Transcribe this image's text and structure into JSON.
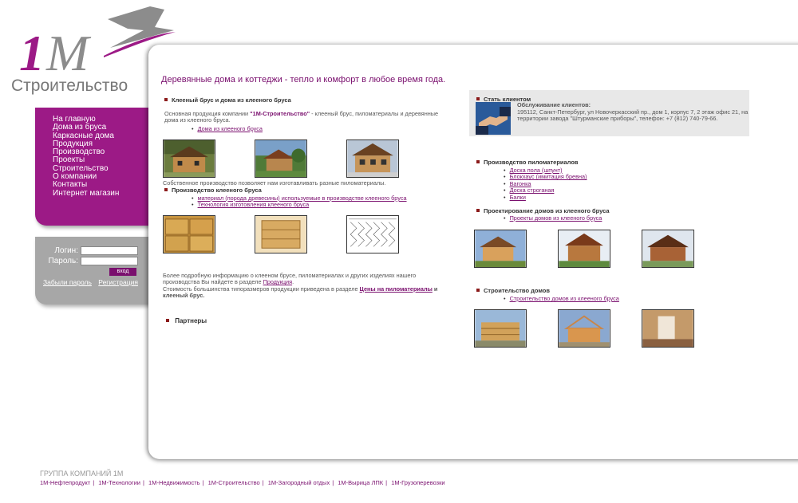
{
  "logo": {
    "mark": "1M",
    "word": "Строительство"
  },
  "menu": [
    "На главную",
    "Дома из бруса",
    "Каркасные дома",
    "Продукция",
    "Производство",
    "Проекты",
    "Строительство",
    "О компании",
    "Контакты",
    "Интернет магазин"
  ],
  "login": {
    "login_label": "Логин:",
    "password_label": "Пароль:",
    "submit": "вход",
    "forgot": "Забыли пароль",
    "register": "Регистрация"
  },
  "headline": "Деревянные дома и коттеджи - тепло и комфорт в любое время года.",
  "left": {
    "sec1_title": "Клееный брус и дома из клееного бруса",
    "sec1_text_a": "Основная продукция компании ",
    "sec1_text_brand": "\"1М-Строительство\"",
    "sec1_text_b": " - клееный брус, пиломатериалы и деревянные дома из клееного бруса.",
    "sec1_link": "Дома из клееного бруса",
    "own_prod": "Собственное производство позволяет нам изготавливать разные пиломатериалы.",
    "sec2_title": "Производство клееного бруса",
    "sec2_links": [
      "материал (порода древесины) используемые в производстве клееного бруса",
      "Технология изготовления клееного бруса"
    ],
    "more_a": "Более подробную информацию о клееном брусе, пиломатериалах и других изделиях нашего производства Вы найдете в разделе ",
    "more_link": "Продукция",
    "more_b": "Стоимость большинства типоразмеров продукции приведена в разделе ",
    "more_link2": "Цены на пиломатериалы",
    "more_c": " и клееный брус.",
    "partners": "Партнеры"
  },
  "client": {
    "title": "Стать клиентом",
    "service": "Обслуживание клиентов:",
    "address": "195112, Санкт-Петербург, ул Новочеркасский пр., дом 1, корпус 7, 2 этаж офис 21, на территории завода \"Штурманские приборы\", телефон: +7 (812) 740-79-66."
  },
  "right": {
    "lumber_title": "Производство пиломатериалов",
    "lumber_links": [
      "Доска пола (шпунт)",
      "Блокхаус (имитация бревна)",
      "Вагонка",
      "Доска строганая",
      "Балки"
    ],
    "design_title": "Проектирование домов из клееного бруса",
    "design_link": "Проекты домов из клееного бруса",
    "build_title": "Строительство домов",
    "build_link": "Строительство домов из клееного бруса"
  },
  "footer": {
    "title": "ГРУППА КОМПАНИЙ 1М",
    "links": [
      "1М-Нефтепродукт",
      "1М-Технологии",
      "1М-Недвижимость",
      "1М-Строительство",
      "1М-Загородный отдых",
      "1М-Вырица ЛПК",
      "1М-Грузоперевозки"
    ]
  },
  "colors": {
    "brand": "#9c1a86",
    "link": "#7a0f6e",
    "login_bg": "#a7a7a7"
  }
}
